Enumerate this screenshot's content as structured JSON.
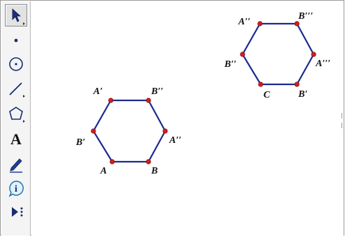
{
  "toolbar": {
    "tools": [
      {
        "name": "arrow-select-tool",
        "icon": "arrow-pointer-icon",
        "selected": true
      },
      {
        "name": "point-tool",
        "icon": "point-icon",
        "selected": false
      },
      {
        "name": "compass-tool",
        "icon": "circle-icon",
        "selected": false
      },
      {
        "name": "straightedge-tool",
        "icon": "line-segment-icon",
        "selected": false
      },
      {
        "name": "polygon-tool",
        "icon": "pentagon-icon",
        "selected": false
      },
      {
        "name": "text-tool",
        "icon": "letter-a-icon",
        "glyph": "A",
        "selected": false
      },
      {
        "name": "marker-tool",
        "icon": "pen-icon",
        "selected": false
      },
      {
        "name": "information-tool",
        "icon": "info-icon",
        "glyph": "i",
        "selected": false
      },
      {
        "name": "custom-tool",
        "icon": "play-more-icon",
        "selected": false
      }
    ]
  },
  "hexagon_left": {
    "labels": {
      "top_left": "A′",
      "top_right": "B′′",
      "right": "A′′",
      "bottom_right": "B",
      "bottom_left": "A",
      "left": "B′"
    }
  },
  "hexagon_right": {
    "labels": {
      "top_left": "A′′",
      "top_right": "B′′′",
      "right": "A′′′",
      "bottom_right": "B′",
      "bottom_left": "C",
      "left": "B′′"
    }
  },
  "colors": {
    "edge": "#1a2a8c",
    "vertex": "#d21f1f",
    "toolbar_bg": "#f4f4f4"
  }
}
